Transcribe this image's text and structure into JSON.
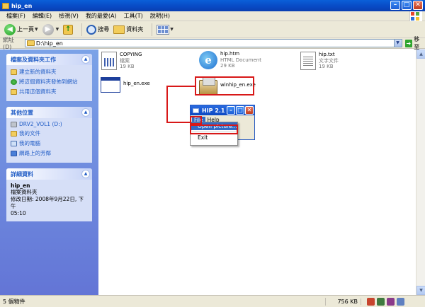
{
  "window": {
    "title": "hip_en"
  },
  "menu": [
    "檔案(F)",
    "編輯(E)",
    "檢視(V)",
    "我的最愛(A)",
    "工具(T)",
    "說明(H)"
  ],
  "toolbar": {
    "back_label": "上一頁",
    "search_label": "搜尋",
    "folders_label": "資料夾"
  },
  "address": {
    "label": "網址(D)",
    "value": "D:\\hip_en",
    "go_label": "移至"
  },
  "tasks_panel": {
    "title": "檔案及資料夾工作",
    "items": [
      "建立新的資料夾",
      "將這個資料夾發佈到網站",
      "共用這個資料夾"
    ]
  },
  "places_panel": {
    "title": "其他位置",
    "items": [
      "DRV2_VOL1 (D:)",
      "我的文件",
      "我的電腦",
      "網路上的芳鄰"
    ]
  },
  "details_panel": {
    "title": "詳細資料",
    "name": "hip_en",
    "type": "檔案資料夾",
    "modified_line1": "修改日期: 2008年9月22日, 下午",
    "modified_line2": "05:10"
  },
  "files": [
    {
      "name": "COPYING",
      "line2": "檔案",
      "line3": "19 KB",
      "icon": "text-grid-icon"
    },
    {
      "name": "hip.htm",
      "line2": "HTML Document",
      "line3": "29 KB",
      "icon": "ie-icon"
    },
    {
      "name": "hip.txt",
      "line2": "文字文件",
      "line3": "19 KB",
      "icon": "text-document-icon"
    },
    {
      "name": "hip_en.exe",
      "line2": "",
      "line3": "",
      "icon": "exe-window-icon"
    },
    {
      "name": "winhip_en.exe",
      "line2": "",
      "line3": "",
      "icon": "installer-package-icon"
    }
  ],
  "hip_window": {
    "title": "HIP 2.1",
    "menu_file": "File",
    "menu_help": "Help",
    "open_item": "Open picture...",
    "exit_item": "Exit"
  },
  "status": {
    "objects": "5 個物件",
    "size": "756 KB"
  }
}
